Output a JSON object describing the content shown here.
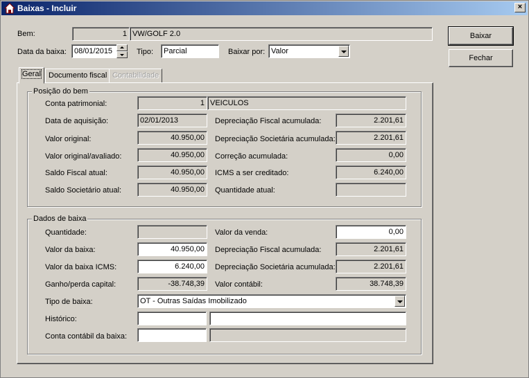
{
  "window": {
    "title": "Baixas - Incluir",
    "close_glyph": "×"
  },
  "header": {
    "bem_label": "Bem:",
    "bem_code": "1",
    "bem_name": "VW/GOLF 2.0",
    "data_baixa_label": "Data da baixa:",
    "data_baixa_value": "08/01/2015",
    "tipo_label": "Tipo:",
    "tipo_value": "Parcial",
    "baixar_por_label": "Baixar por:",
    "baixar_por_value": "Valor"
  },
  "buttons": {
    "baixar": "Baixar",
    "fechar": "Fechar"
  },
  "tabs": [
    {
      "label": "Geral",
      "state": "active"
    },
    {
      "label": "Documento fiscal",
      "state": "normal"
    },
    {
      "label": "Contabilidade",
      "state": "disabled"
    }
  ],
  "posicao": {
    "title": "Posição do bem",
    "conta_patrimonial_label": "Conta patrimonial:",
    "conta_patrimonial_code": "1",
    "conta_patrimonial_name": "VEICULOS",
    "data_aquisicao_label": "Data de aquisição:",
    "data_aquisicao_value": "02/01/2013",
    "valor_original_label": "Valor original:",
    "valor_original_value": "40.950,00",
    "valor_avaliado_label": "Valor original/avaliado:",
    "valor_avaliado_value": "40.950,00",
    "saldo_fiscal_label": "Saldo Fiscal atual:",
    "saldo_fiscal_value": "40.950,00",
    "saldo_societario_label": "Saldo Societário atual:",
    "saldo_societario_value": "40.950,00",
    "dep_fiscal_label": "Depreciação Fiscal acumulada:",
    "dep_fiscal_value": "2.201,61",
    "dep_societaria_label": "Depreciação Societária acumulada:",
    "dep_societaria_value": "2.201,61",
    "correcao_label": "Correção acumulada:",
    "correcao_value": "0,00",
    "icms_label": "ICMS a ser creditado:",
    "icms_value": "6.240,00",
    "quantidade_label": "Quantidade atual:",
    "quantidade_value": ""
  },
  "dados": {
    "title": "Dados de baixa",
    "quantidade_label": "Quantidade:",
    "quantidade_value": "",
    "valor_baixa_label": "Valor da baixa:",
    "valor_baixa_value": "40.950,00",
    "valor_icms_label": "Valor da baixa ICMS:",
    "valor_icms_value": "6.240,00",
    "ganho_label": "Ganho/perda capital:",
    "ganho_value": "-38.748,39",
    "valor_venda_label": "Valor da venda:",
    "valor_venda_value": "0,00",
    "dep_fiscal_label": "Depreciação Fiscal acumulada:",
    "dep_fiscal_value": "2.201,61",
    "dep_societaria_label": "Depreciação Societária acumulada:",
    "dep_societaria_value": "2.201,61",
    "valor_contabil_label": "Valor contábil:",
    "valor_contabil_value": "38.748,39",
    "tipo_baixa_label": "Tipo de baixa:",
    "tipo_baixa_value": "OT - Outras Saídas Imobilizado",
    "historico_label": "Histórico:",
    "historico_code": "",
    "historico_text": "",
    "conta_contabil_label": "Conta contábil da baixa:",
    "conta_contabil_code": "",
    "conta_contabil_text": ""
  }
}
